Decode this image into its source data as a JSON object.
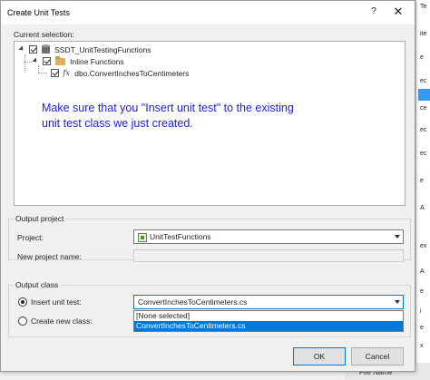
{
  "dialog": {
    "title": "Create Unit Tests",
    "help": "?",
    "close": "✕"
  },
  "current_selection": {
    "label": "Current selection:",
    "tree": [
      {
        "label": "SSDT_UnitTestingFunctions",
        "icon": "database-icon",
        "checked": true
      },
      {
        "label": "Inline Functions",
        "icon": "folder-icon",
        "checked": true
      },
      {
        "label": "dbo.ConvertInchesToCentimeters",
        "icon": "function-icon",
        "icon_text": "fx",
        "checked": true
      }
    ],
    "instruction": "Make sure that you \"Insert unit test\" to the existing\nunit test class we just created."
  },
  "output_project": {
    "group_title": "Output project",
    "project_label": "Project:",
    "project_value": "UnitTestFunctions",
    "new_project_label": "New project name:",
    "new_project_value": ""
  },
  "output_class": {
    "group_title": "Output class",
    "insert_label": "Insert unit test:",
    "insert_checked": true,
    "insert_value": "ConvertInchesToCentimeters.cs",
    "create_label": "Create new class:",
    "create_checked": false,
    "dropdown_options": [
      {
        "label": "[None selected]",
        "selected": false
      },
      {
        "label": "ConvertInchesToCentimeters.cs",
        "selected": true
      }
    ]
  },
  "buttons": {
    "ok": "OK",
    "cancel": "Cancel"
  },
  "background": {
    "right_fragments": [
      "Te",
      "ite",
      "e",
      "ec",
      "ce",
      "ec",
      "ec",
      "e",
      "A",
      "ex",
      "A",
      "e",
      "i",
      "e",
      "x"
    ],
    "bottom_text": "File Name"
  },
  "colors": {
    "instruction_text": "#1d1de0",
    "selection": "#0078d7"
  }
}
